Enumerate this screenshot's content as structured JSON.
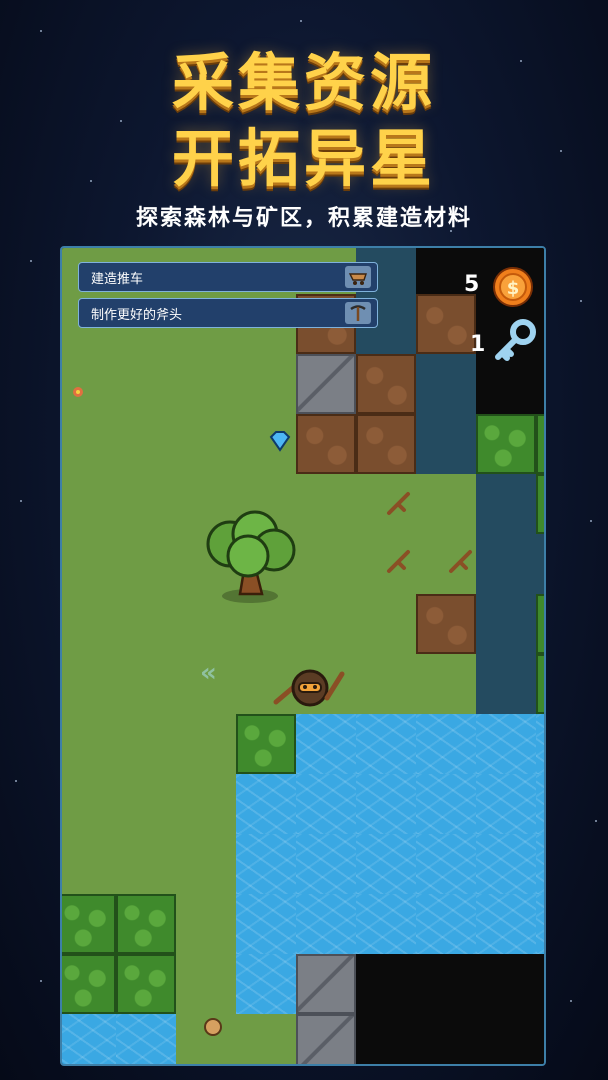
{
  "headline": {
    "line1": "采集资源",
    "line2": "开拓异星"
  },
  "subtitle": "探索森林与矿区，积累建造材料",
  "tasks": [
    {
      "label": "建造推车",
      "icon": "cart-icon"
    },
    {
      "label": "制作更好的斧头",
      "icon": "pickaxe-icon"
    }
  ],
  "resources": {
    "coins": {
      "count": "5",
      "icon": "coin-icon"
    },
    "keys": {
      "count": "1",
      "icon": "key-icon"
    }
  },
  "map_rows": [
    "ggggg.kkk",
    "ggggd.dkk",
    "ggggsd.kk",
    "ggggdd.bb",
    "ggggggg.b",
    "ggggggg..",
    "ggggggd.b",
    "ggggggg.b",
    "gggbwwwww",
    "gggwwwwww",
    "gggwwwwww",
    "bbgwwwwww",
    "bbgwskkkk",
    "wwggskkkk"
  ],
  "colors": {
    "headline": "#ffd24a",
    "grass": "#6f9c45",
    "water": "#3aa8e3",
    "frame_border": "#3d7fa8"
  }
}
